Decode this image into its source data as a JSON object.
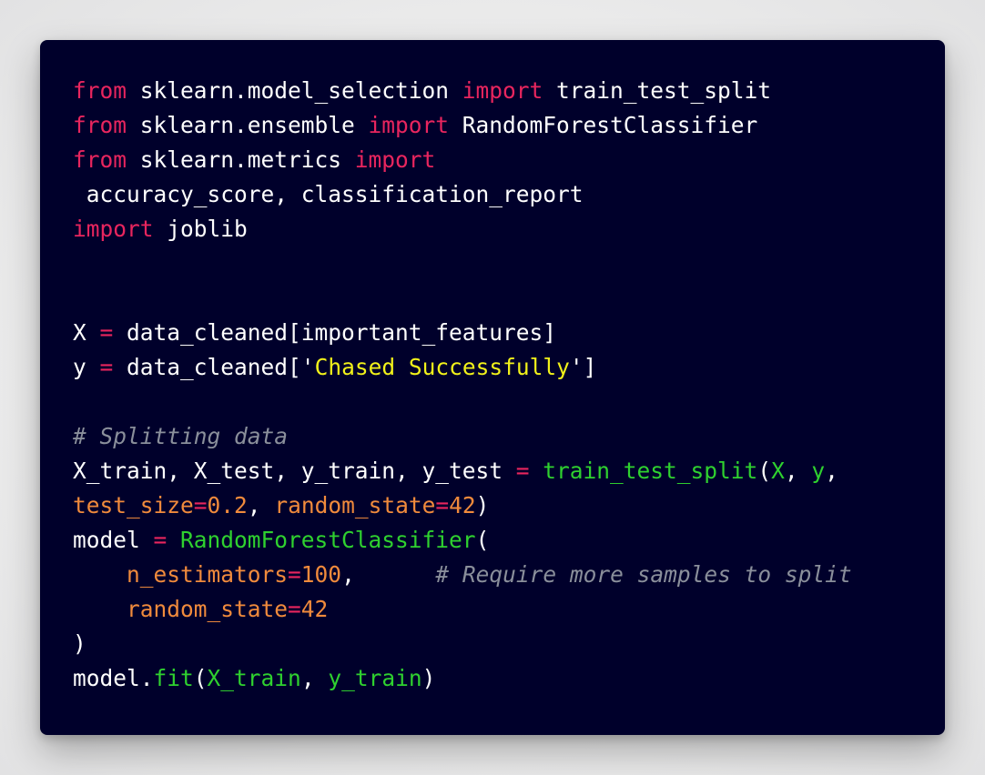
{
  "code": {
    "lines": [
      [
        {
          "t": "from",
          "k": "kw"
        },
        {
          "t": " sklearn.model_selection ",
          "k": "plain"
        },
        {
          "t": "import",
          "k": "kw"
        },
        {
          "t": " train_test_split",
          "k": "plain"
        }
      ],
      [
        {
          "t": "from",
          "k": "kw"
        },
        {
          "t": " sklearn.ensemble ",
          "k": "plain"
        },
        {
          "t": "import",
          "k": "kw"
        },
        {
          "t": " RandomForestClassifier",
          "k": "plain"
        }
      ],
      [
        {
          "t": "from",
          "k": "kw"
        },
        {
          "t": " sklearn.metrics ",
          "k": "plain"
        },
        {
          "t": "import",
          "k": "kw"
        }
      ],
      [
        {
          "t": " accuracy_score, classification_report",
          "k": "plain"
        }
      ],
      [
        {
          "t": "import",
          "k": "kw"
        },
        {
          "t": " joblib",
          "k": "plain"
        }
      ],
      [],
      [],
      [
        {
          "t": "X ",
          "k": "plain"
        },
        {
          "t": "=",
          "k": "op"
        },
        {
          "t": " data_cleaned[important_features]",
          "k": "plain"
        }
      ],
      [
        {
          "t": "y ",
          "k": "plain"
        },
        {
          "t": "=",
          "k": "op"
        },
        {
          "t": " data_cleaned[",
          "k": "plain"
        },
        {
          "t": "'",
          "k": "plain"
        },
        {
          "t": "Chased Successfully",
          "k": "str"
        },
        {
          "t": "'",
          "k": "plain"
        },
        {
          "t": "]",
          "k": "plain"
        }
      ],
      [],
      [
        {
          "t": "# Splitting data",
          "k": "cmt"
        }
      ],
      [
        {
          "t": "X_train, X_test, y_train, y_test ",
          "k": "plain"
        },
        {
          "t": "=",
          "k": "op"
        },
        {
          "t": " ",
          "k": "plain"
        },
        {
          "t": "train_test_split",
          "k": "fn"
        },
        {
          "t": "(",
          "k": "plain"
        },
        {
          "t": "X",
          "k": "arg"
        },
        {
          "t": ", ",
          "k": "plain"
        },
        {
          "t": "y",
          "k": "arg"
        },
        {
          "t": ",",
          "k": "plain"
        }
      ],
      [
        {
          "t": "test_size",
          "k": "param"
        },
        {
          "t": "=",
          "k": "op"
        },
        {
          "t": "0.2",
          "k": "num"
        },
        {
          "t": ", ",
          "k": "plain"
        },
        {
          "t": "random_state",
          "k": "param"
        },
        {
          "t": "=",
          "k": "op"
        },
        {
          "t": "42",
          "k": "num"
        },
        {
          "t": ")",
          "k": "plain"
        }
      ],
      [
        {
          "t": "model ",
          "k": "plain"
        },
        {
          "t": "=",
          "k": "op"
        },
        {
          "t": " ",
          "k": "plain"
        },
        {
          "t": "RandomForestClassifier",
          "k": "fn"
        },
        {
          "t": "(",
          "k": "plain"
        }
      ],
      [
        {
          "t": "    ",
          "k": "plain"
        },
        {
          "t": "n_estimators",
          "k": "param"
        },
        {
          "t": "=",
          "k": "op"
        },
        {
          "t": "100",
          "k": "num"
        },
        {
          "t": ",      ",
          "k": "plain"
        },
        {
          "t": "# Require more samples to split",
          "k": "cmt"
        }
      ],
      [
        {
          "t": "    ",
          "k": "plain"
        },
        {
          "t": "random_state",
          "k": "param"
        },
        {
          "t": "=",
          "k": "op"
        },
        {
          "t": "42",
          "k": "num"
        }
      ],
      [
        {
          "t": ")",
          "k": "plain"
        }
      ],
      [
        {
          "t": "model.",
          "k": "plain"
        },
        {
          "t": "fit",
          "k": "fn"
        },
        {
          "t": "(",
          "k": "plain"
        },
        {
          "t": "X_train",
          "k": "arg"
        },
        {
          "t": ", ",
          "k": "plain"
        },
        {
          "t": "y_train",
          "k": "arg"
        },
        {
          "t": ")",
          "k": "plain"
        }
      ]
    ]
  },
  "colors": {
    "background": "#00002b",
    "keyword": "#e8255e",
    "string": "#f2f21a",
    "comment": "#8a8f9b",
    "function": "#2fd12f",
    "parameter": "#f08a3c"
  }
}
